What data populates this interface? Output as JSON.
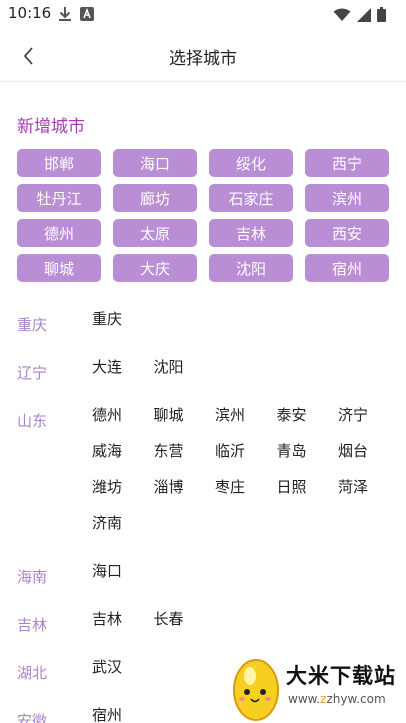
{
  "status_bar": {
    "time": "10:16",
    "left_icons": [
      "download-icon",
      "app-badge-icon"
    ],
    "right_icons": [
      "wifi-icon",
      "signal-icon",
      "battery-icon"
    ]
  },
  "nav": {
    "title": "选择城市",
    "back_icon": "chevron-left-icon"
  },
  "new_cities": {
    "title": "新增城市",
    "items": [
      "邯郸",
      "海口",
      "绥化",
      "西宁",
      "牡丹江",
      "廊坊",
      "石家庄",
      "滨州",
      "德州",
      "太原",
      "吉林",
      "西安",
      "聊城",
      "大庆",
      "沈阳",
      "宿州"
    ]
  },
  "provinces": [
    {
      "name": "重庆",
      "cities": [
        "重庆"
      ]
    },
    {
      "name": "辽宁",
      "cities": [
        "大连",
        "沈阳"
      ]
    },
    {
      "name": "山东",
      "cities": [
        "德州",
        "聊城",
        "滨州",
        "泰安",
        "济宁",
        "威海",
        "东营",
        "临沂",
        "青岛",
        "烟台",
        "潍坊",
        "淄博",
        "枣庄",
        "日照",
        "菏泽",
        "济南"
      ]
    },
    {
      "name": "海南",
      "cities": [
        "海口"
      ]
    },
    {
      "name": "吉林",
      "cities": [
        "吉林",
        "长春"
      ]
    },
    {
      "name": "湖北",
      "cities": [
        "武汉"
      ]
    },
    {
      "name": "安徽",
      "cities": [
        "宿州"
      ]
    }
  ],
  "watermark": {
    "title": "大米下载站",
    "url_prefix": "www.",
    "url_z": "z",
    "url_suffix": "zhyw.com"
  },
  "colors": {
    "accent_text": "#a53fae",
    "chip_bg": "#b98ed4",
    "province_text": "#a985c8"
  }
}
